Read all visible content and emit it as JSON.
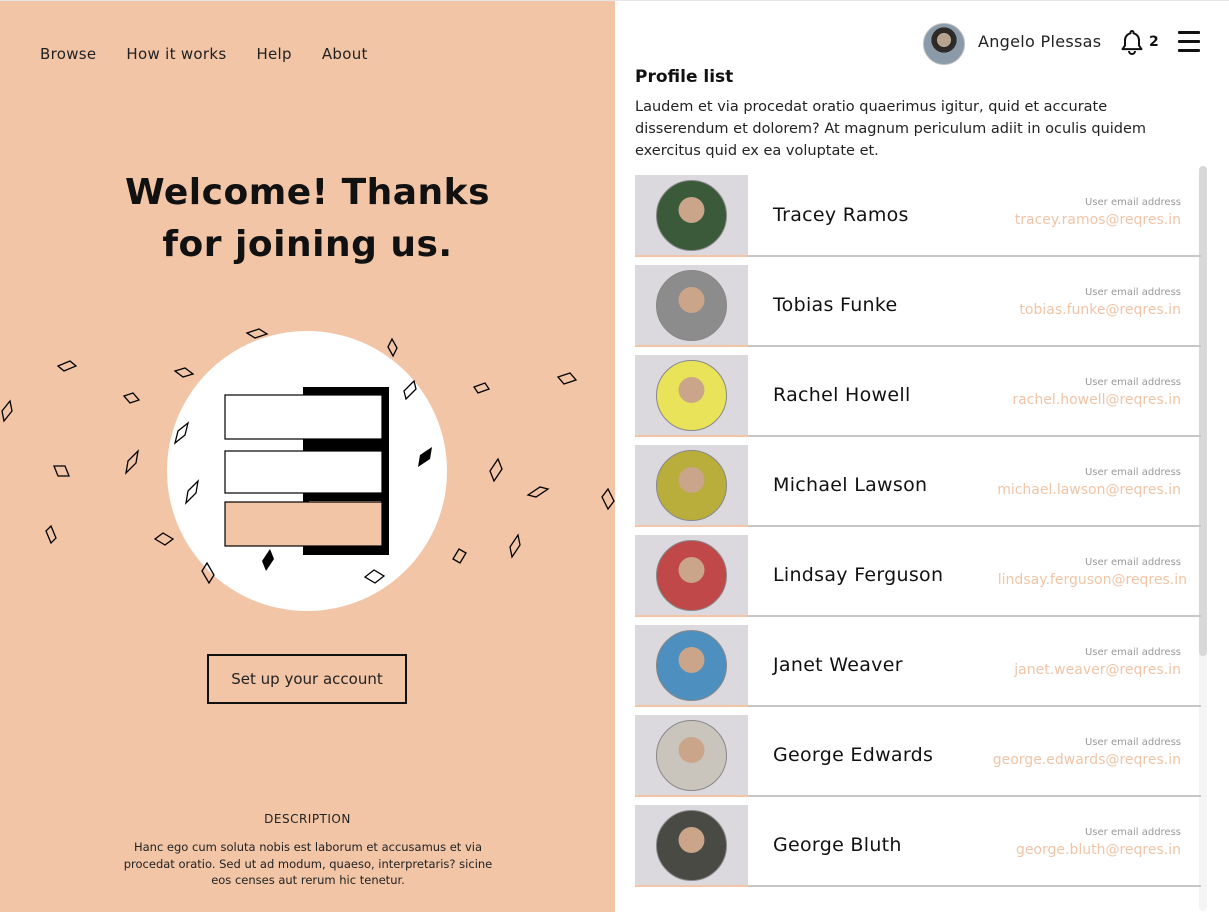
{
  "nav": {
    "items": [
      "Browse",
      "How it works",
      "Help",
      "About"
    ]
  },
  "hero": {
    "line1": "Welcome! Thanks",
    "line2": "for joining us."
  },
  "setup_button": "Set up your account",
  "description": {
    "title": "DESCRIPTION",
    "text": "Hanc ego cum soluta nobis est laborum et accusamus et via procedat oratio. Sed ut ad modum, quaeso, interpretaris? sicine eos censes aut rerum hic tenetur."
  },
  "topbar": {
    "user_name": "Angelo Plessas",
    "notification_count": "2"
  },
  "profile_list": {
    "title": "Profile list",
    "description": "Laudem et via procedat oratio quaerimus igitur, quid et accurate disserendum et dolorem? At magnum periculum adiit in oculis quidem exercitus quid ex ea voluptate et.",
    "email_label": "User email address",
    "profiles": [
      {
        "name": "Tracey Ramos",
        "email": "tracey.ramos@reqres.in",
        "color": "#3b5a3a"
      },
      {
        "name": "Tobias Funke",
        "email": "tobias.funke@reqres.in",
        "color": "#8c8c8c"
      },
      {
        "name": "Rachel Howell",
        "email": "rachel.howell@reqres.in",
        "color": "#e9e35a"
      },
      {
        "name": "Michael Lawson",
        "email": "michael.lawson@reqres.in",
        "color": "#b9ad3c"
      },
      {
        "name": "Lindsay Ferguson",
        "email": "lindsay.ferguson@reqres.in",
        "color": "#c04848"
      },
      {
        "name": "Janet Weaver",
        "email": "janet.weaver@reqres.in",
        "color": "#4d8fbf"
      },
      {
        "name": "George Edwards",
        "email": "george.edwards@reqres.in",
        "color": "#c9c4bc"
      },
      {
        "name": "George Bluth",
        "email": "george.bluth@reqres.in",
        "color": "#4a4a44"
      }
    ]
  },
  "colors": {
    "accent": "#f2c5a6",
    "email": "#f0c4a6",
    "photo_bg": "#dcd9de"
  }
}
